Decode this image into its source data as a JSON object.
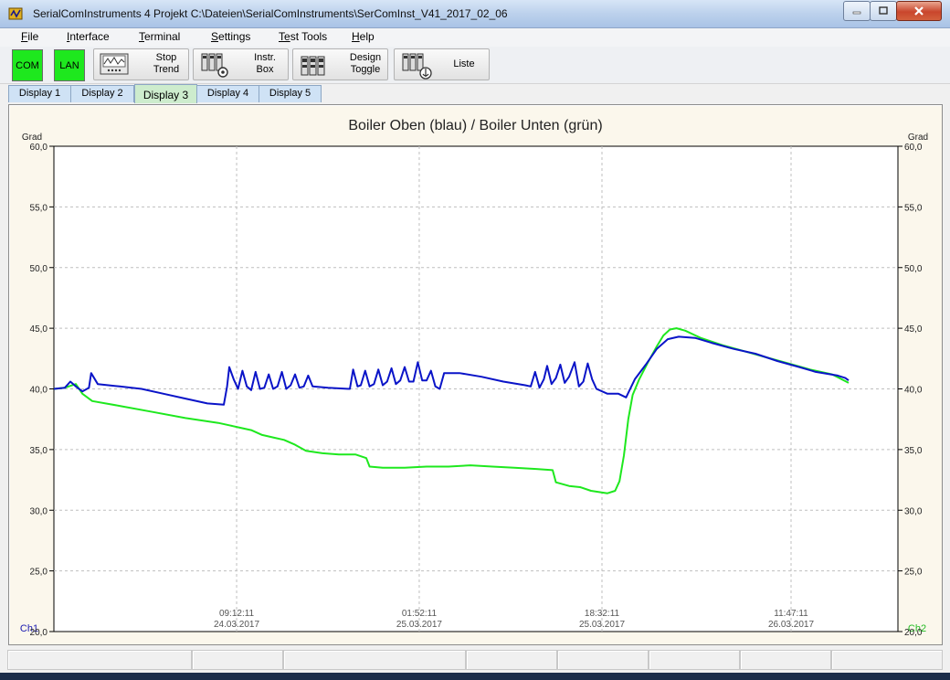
{
  "window": {
    "title": "SerialComInstruments 4    Projekt  C:\\Dateien\\SerialComInstruments\\SerComInst_V41_2017_02_06",
    "controls": [
      "minimize-icon",
      "maximize-icon",
      "close-icon"
    ]
  },
  "menu": {
    "items": [
      {
        "mnemonic": "F",
        "rest": "ile"
      },
      {
        "mnemonic": "I",
        "rest": "nterface"
      },
      {
        "mnemonic": "T",
        "rest": "erminal"
      },
      {
        "mnemonic": "S",
        "rest": "ettings"
      },
      {
        "mnemonic": "Te",
        "rest": "st Tools"
      },
      {
        "mnemonic": "H",
        "rest": "elp"
      }
    ]
  },
  "toolbar": {
    "com": "COM",
    "lan": "LAN",
    "status_color": "#1ee81e",
    "stop_trend": {
      "line1": "Stop",
      "line2": "Trend"
    },
    "instr_box": {
      "line1": "Instr.",
      "line2": "Box"
    },
    "design_toggle": {
      "line1": "Design",
      "line2": "Toggle"
    },
    "liste": "Liste"
  },
  "tabs": [
    "Display 1",
    "Display 2",
    "Display 3",
    "Display 4",
    "Display 5"
  ],
  "active_tab": 2,
  "chart_data": {
    "type": "line",
    "title": "Boiler Oben (blau) / Boiler Unten (grün)",
    "ylabel_left": "Grad",
    "ylabel_right": "Grad",
    "ylim": [
      20.0,
      60.0
    ],
    "yticks": [
      "20,0",
      "25,0",
      "30,0",
      "35,0",
      "40,0",
      "45,0",
      "50,0",
      "55,0",
      "60,0"
    ],
    "xtick_labels": [
      {
        "time": "09:12:11",
        "date": "24.03.2017"
      },
      {
        "time": "01:52:11",
        "date": "25.03.2017"
      },
      {
        "time": "18:32:11",
        "date": "25.03.2017"
      },
      {
        "time": "11:47:11",
        "date": "26.03.2017"
      }
    ],
    "xtick_hours": [
      16.67,
      33.33,
      50.0,
      67.25
    ],
    "xlim_hours": [
      0,
      77
    ],
    "x_unit_note": "hours",
    "channel_left": "Ch1",
    "channel_right": "Ch2",
    "grid": true,
    "series": [
      {
        "name": "Boiler Oben",
        "color": "#0a14c8",
        "points": [
          [
            0,
            40.0
          ],
          [
            1.0,
            40.1
          ],
          [
            1.5,
            40.6
          ],
          [
            2.0,
            40.2
          ],
          [
            2.6,
            39.8
          ],
          [
            3.2,
            40.1
          ],
          [
            3.4,
            41.3
          ],
          [
            3.6,
            41.0
          ],
          [
            4.0,
            40.4
          ],
          [
            6,
            40.2
          ],
          [
            8,
            40.0
          ],
          [
            10,
            39.6
          ],
          [
            12,
            39.2
          ],
          [
            14,
            38.8
          ],
          [
            15.5,
            38.7
          ],
          [
            15.8,
            40.2
          ],
          [
            16.0,
            41.8
          ],
          [
            16.4,
            40.8
          ],
          [
            16.8,
            40.0
          ],
          [
            17.2,
            41.5
          ],
          [
            17.6,
            40.2
          ],
          [
            18.0,
            39.9
          ],
          [
            18.4,
            41.4
          ],
          [
            18.8,
            40.0
          ],
          [
            19.2,
            40.1
          ],
          [
            19.6,
            41.2
          ],
          [
            20.0,
            40.0
          ],
          [
            20.4,
            40.2
          ],
          [
            20.8,
            41.4
          ],
          [
            21.2,
            40.0
          ],
          [
            21.6,
            40.3
          ],
          [
            22.0,
            41.2
          ],
          [
            22.4,
            40.1
          ],
          [
            22.8,
            40.2
          ],
          [
            23.2,
            41.1
          ],
          [
            23.6,
            40.2
          ],
          [
            25,
            40.1
          ],
          [
            27.0,
            40.0
          ],
          [
            27.3,
            41.6
          ],
          [
            27.7,
            40.2
          ],
          [
            28.0,
            40.3
          ],
          [
            28.4,
            41.5
          ],
          [
            28.8,
            40.2
          ],
          [
            29.2,
            40.4
          ],
          [
            29.6,
            41.6
          ],
          [
            30.0,
            40.3
          ],
          [
            30.4,
            40.6
          ],
          [
            30.8,
            41.7
          ],
          [
            31.2,
            40.4
          ],
          [
            31.6,
            40.7
          ],
          [
            32.0,
            41.8
          ],
          [
            32.4,
            40.6
          ],
          [
            32.8,
            40.6
          ],
          [
            33.2,
            42.2
          ],
          [
            33.6,
            40.7
          ],
          [
            34.0,
            40.7
          ],
          [
            34.4,
            41.5
          ],
          [
            34.8,
            40.2
          ],
          [
            35.2,
            40.0
          ],
          [
            35.6,
            41.3
          ],
          [
            37,
            41.3
          ],
          [
            39,
            41.0
          ],
          [
            41,
            40.6
          ],
          [
            43,
            40.3
          ],
          [
            43.5,
            40.2
          ],
          [
            43.9,
            41.4
          ],
          [
            44.3,
            40.1
          ],
          [
            44.7,
            40.8
          ],
          [
            45.0,
            41.9
          ],
          [
            45.4,
            40.4
          ],
          [
            45.8,
            40.9
          ],
          [
            46.2,
            42.0
          ],
          [
            46.6,
            40.5
          ],
          [
            47.0,
            41.0
          ],
          [
            47.5,
            42.2
          ],
          [
            47.9,
            40.2
          ],
          [
            48.3,
            40.6
          ],
          [
            48.7,
            42.1
          ],
          [
            49.1,
            40.8
          ],
          [
            49.5,
            40.0
          ],
          [
            50.5,
            39.6
          ],
          [
            51.5,
            39.6
          ],
          [
            52.2,
            39.3
          ],
          [
            53.0,
            40.8
          ],
          [
            54.0,
            42.0
          ],
          [
            55.0,
            43.3
          ],
          [
            56.0,
            44.1
          ],
          [
            57.0,
            44.3
          ],
          [
            58.5,
            44.2
          ],
          [
            60,
            43.8
          ],
          [
            62,
            43.3
          ],
          [
            64,
            42.9
          ],
          [
            66,
            42.3
          ],
          [
            68,
            41.8
          ],
          [
            69.5,
            41.4
          ],
          [
            71.5,
            41.1
          ],
          [
            72.2,
            40.9
          ],
          [
            72.5,
            40.7
          ]
        ]
      },
      {
        "name": "Boiler Unten",
        "color": "#1ee81e",
        "points": [
          [
            0,
            40.0
          ],
          [
            1.0,
            40.1
          ],
          [
            2.0,
            40.4
          ],
          [
            2.6,
            39.6
          ],
          [
            3.5,
            39.0
          ],
          [
            6,
            38.6
          ],
          [
            9,
            38.1
          ],
          [
            12,
            37.6
          ],
          [
            15,
            37.2
          ],
          [
            16,
            37.0
          ],
          [
            17,
            36.8
          ],
          [
            18,
            36.6
          ],
          [
            19,
            36.2
          ],
          [
            20,
            36.0
          ],
          [
            21,
            35.8
          ],
          [
            22,
            35.4
          ],
          [
            23,
            34.9
          ],
          [
            24.5,
            34.7
          ],
          [
            26,
            34.6
          ],
          [
            27.5,
            34.6
          ],
          [
            28.5,
            34.3
          ],
          [
            28.8,
            33.6
          ],
          [
            30,
            33.5
          ],
          [
            32,
            33.5
          ],
          [
            34,
            33.6
          ],
          [
            36,
            33.6
          ],
          [
            38,
            33.7
          ],
          [
            40,
            33.6
          ],
          [
            42,
            33.5
          ],
          [
            44,
            33.4
          ],
          [
            45.5,
            33.3
          ],
          [
            45.8,
            32.3
          ],
          [
            47,
            32.0
          ],
          [
            48,
            31.9
          ],
          [
            49,
            31.6
          ],
          [
            50.5,
            31.4
          ],
          [
            51.2,
            31.6
          ],
          [
            51.6,
            32.4
          ],
          [
            52.0,
            34.5
          ],
          [
            52.4,
            37.5
          ],
          [
            52.8,
            39.5
          ],
          [
            53.4,
            40.8
          ],
          [
            54.2,
            42.2
          ],
          [
            55.0,
            43.5
          ],
          [
            55.6,
            44.4
          ],
          [
            56.2,
            44.9
          ],
          [
            56.8,
            45.0
          ],
          [
            57.6,
            44.8
          ],
          [
            59,
            44.2
          ],
          [
            61,
            43.6
          ],
          [
            63,
            43.1
          ],
          [
            65,
            42.6
          ],
          [
            67,
            42.1
          ],
          [
            69,
            41.6
          ],
          [
            71,
            41.2
          ],
          [
            72.5,
            40.5
          ]
        ]
      }
    ]
  }
}
